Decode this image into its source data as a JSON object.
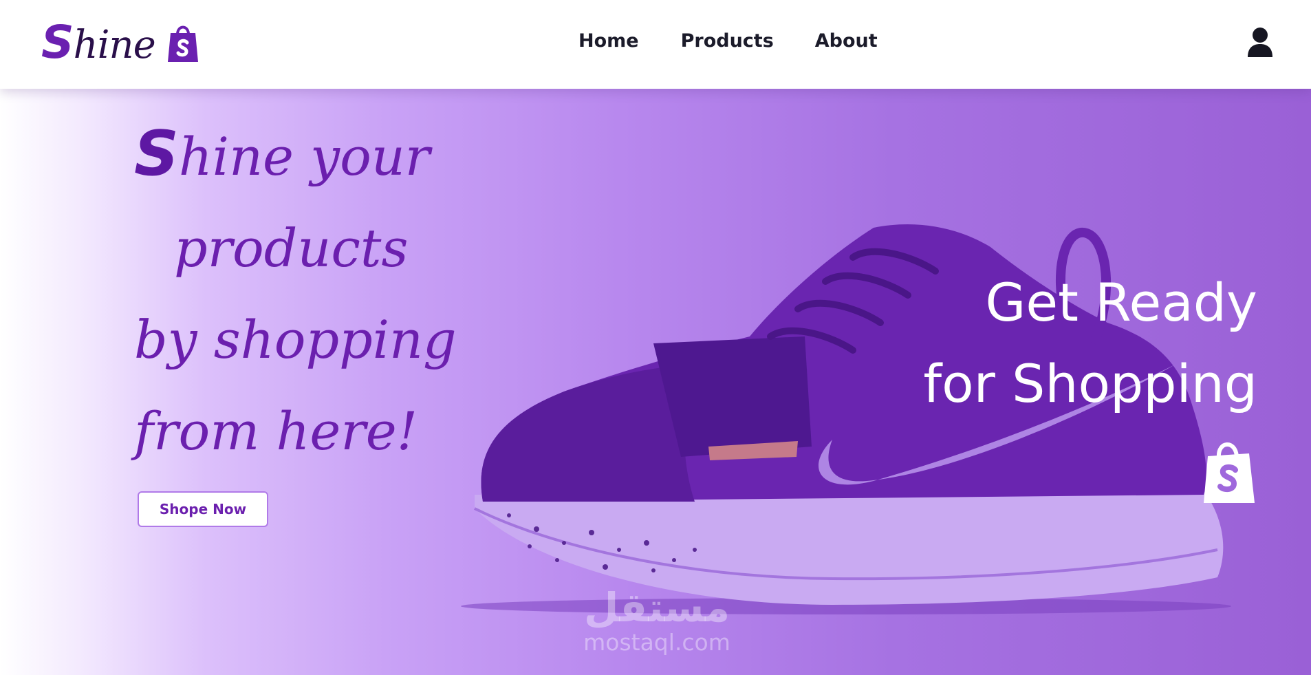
{
  "brand": {
    "name_initial": "S",
    "name_rest": "hine",
    "logo_icon": "shopping-bag-icon",
    "accent_color": "#6b1fae"
  },
  "nav": {
    "links": [
      "Home",
      "Products",
      "About"
    ],
    "user_icon": "user-icon"
  },
  "hero": {
    "headline_initial": "S",
    "headline_line1_rest": "hine your",
    "headline_line2": "products",
    "headline_line3": "by shopping",
    "headline_line4": "from here!",
    "cta_label": "Shope Now",
    "tagline_line1": "Get Ready",
    "tagline_line2": "for Shopping",
    "tagline_icon": "shopping-bag-icon",
    "background_image": "purple-sneaker-image",
    "watermark_arabic": "مستقل",
    "watermark_text": "mostaql.com"
  }
}
